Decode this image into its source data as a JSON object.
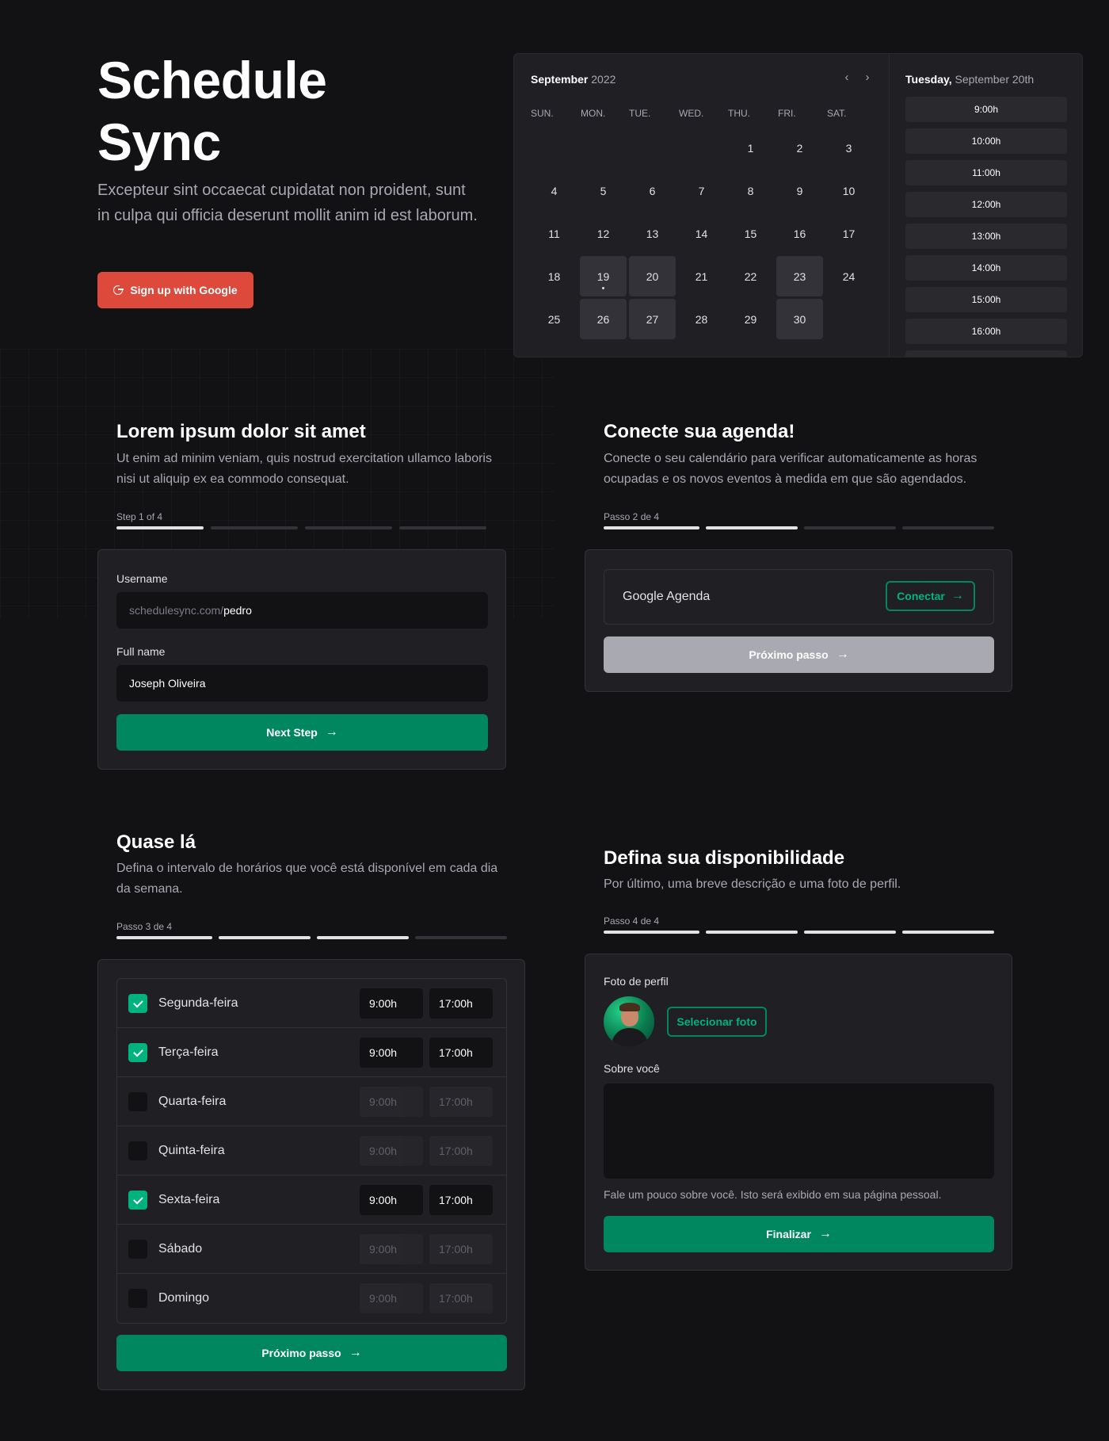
{
  "hero": {
    "title_line1": "Schedule",
    "title_line2": "Sync",
    "description": "Excepteur sint occaecat cupidatat non proident, sunt in culpa qui officia deserunt mollit anim id est laborum.",
    "google_button": "Sign up with Google",
    "google_color": "#dd4a3c"
  },
  "calendar": {
    "month": "September",
    "year": "2022",
    "weekdays": [
      "SUN.",
      "MON.",
      "TUE.",
      "WED.",
      "THU.",
      "FRI.",
      "SAT."
    ],
    "days": [
      {
        "n": "1",
        "avail": false
      },
      {
        "n": "2",
        "avail": false
      },
      {
        "n": "3",
        "avail": false
      },
      {
        "n": "4",
        "avail": false
      },
      {
        "n": "5",
        "avail": false
      },
      {
        "n": "6",
        "avail": false
      },
      {
        "n": "7",
        "avail": false
      },
      {
        "n": "8",
        "avail": false
      },
      {
        "n": "9",
        "avail": false
      },
      {
        "n": "10",
        "avail": false
      },
      {
        "n": "11",
        "avail": false
      },
      {
        "n": "12",
        "avail": false
      },
      {
        "n": "13",
        "avail": false
      },
      {
        "n": "14",
        "avail": false
      },
      {
        "n": "15",
        "avail": false
      },
      {
        "n": "16",
        "avail": false
      },
      {
        "n": "17",
        "avail": false
      },
      {
        "n": "18",
        "avail": false
      },
      {
        "n": "19",
        "avail": true,
        "today": true
      },
      {
        "n": "20",
        "avail": true
      },
      {
        "n": "21",
        "avail": false
      },
      {
        "n": "22",
        "avail": false
      },
      {
        "n": "23",
        "avail": true
      },
      {
        "n": "24",
        "avail": false
      },
      {
        "n": "25",
        "avail": false
      },
      {
        "n": "26",
        "avail": true
      },
      {
        "n": "27",
        "avail": true
      },
      {
        "n": "28",
        "avail": false
      },
      {
        "n": "29",
        "avail": false
      },
      {
        "n": "30",
        "avail": true
      }
    ],
    "first_weekday_index": 4,
    "selected_weekday": "Tuesday,",
    "selected_date": "September 20th",
    "times": [
      "9:00h",
      "10:00h",
      "11:00h",
      "12:00h",
      "13:00h",
      "14:00h",
      "15:00h",
      "16:00h"
    ]
  },
  "step1": {
    "title": "Lorem ipsum dolor sit amet",
    "description": "Ut enim ad minim veniam, quis nostrud exercitation ullamco laboris nisi ut aliquip ex ea commodo consequat.",
    "step_label": "Step 1 of 4",
    "progress": 1,
    "username_label": "Username",
    "username_prefix": "schedulesync.com/",
    "username_value": "pedro",
    "fullname_label": "Full name",
    "fullname_value": "Joseph Oliveira",
    "button": "Next Step"
  },
  "step2": {
    "title": "Conecte sua agenda!",
    "description": "Conecte o seu calendário para verificar automaticamente as horas ocupadas e os novos eventos à medida em que são agendados.",
    "step_label": "Passo 2 de 4",
    "progress": 2,
    "provider": "Google Agenda",
    "connect_button": "Conectar",
    "next_button": "Próximo passo"
  },
  "step3": {
    "title": "Quase lá",
    "description": "Defina o intervalo de horários que você está disponível em cada dia da semana.",
    "step_label": "Passo 3 de 4",
    "progress": 3,
    "days": [
      {
        "name": "Segunda-feira",
        "checked": true,
        "start": "9:00h",
        "end": "17:00h"
      },
      {
        "name": "Terça-feira",
        "checked": true,
        "start": "9:00h",
        "end": "17:00h"
      },
      {
        "name": "Quarta-feira",
        "checked": false,
        "start": "9:00h",
        "end": "17:00h"
      },
      {
        "name": "Quinta-feira",
        "checked": false,
        "start": "9:00h",
        "end": "17:00h"
      },
      {
        "name": "Sexta-feira",
        "checked": true,
        "start": "9:00h",
        "end": "17:00h"
      },
      {
        "name": "Sábado",
        "checked": false,
        "start": "9:00h",
        "end": "17:00h"
      },
      {
        "name": "Domingo",
        "checked": false,
        "start": "9:00h",
        "end": "17:00h"
      }
    ],
    "button": "Próximo passo"
  },
  "step4": {
    "title": "Defina sua disponibilidade",
    "description": "Por último, uma breve descrição e uma foto de perfil.",
    "step_label": "Passo 4 de 4",
    "progress": 4,
    "photo_label": "Foto de perfil",
    "select_photo_button": "Selecionar foto",
    "about_label": "Sobre você",
    "about_value": "",
    "hint": "Fale um pouco sobre você. Isto será exibido em sua página pessoal.",
    "button": "Finalizar"
  },
  "colors": {
    "background": "#121214",
    "card": "#202024",
    "primary": "#00875f",
    "primary_light": "#00b37e"
  }
}
